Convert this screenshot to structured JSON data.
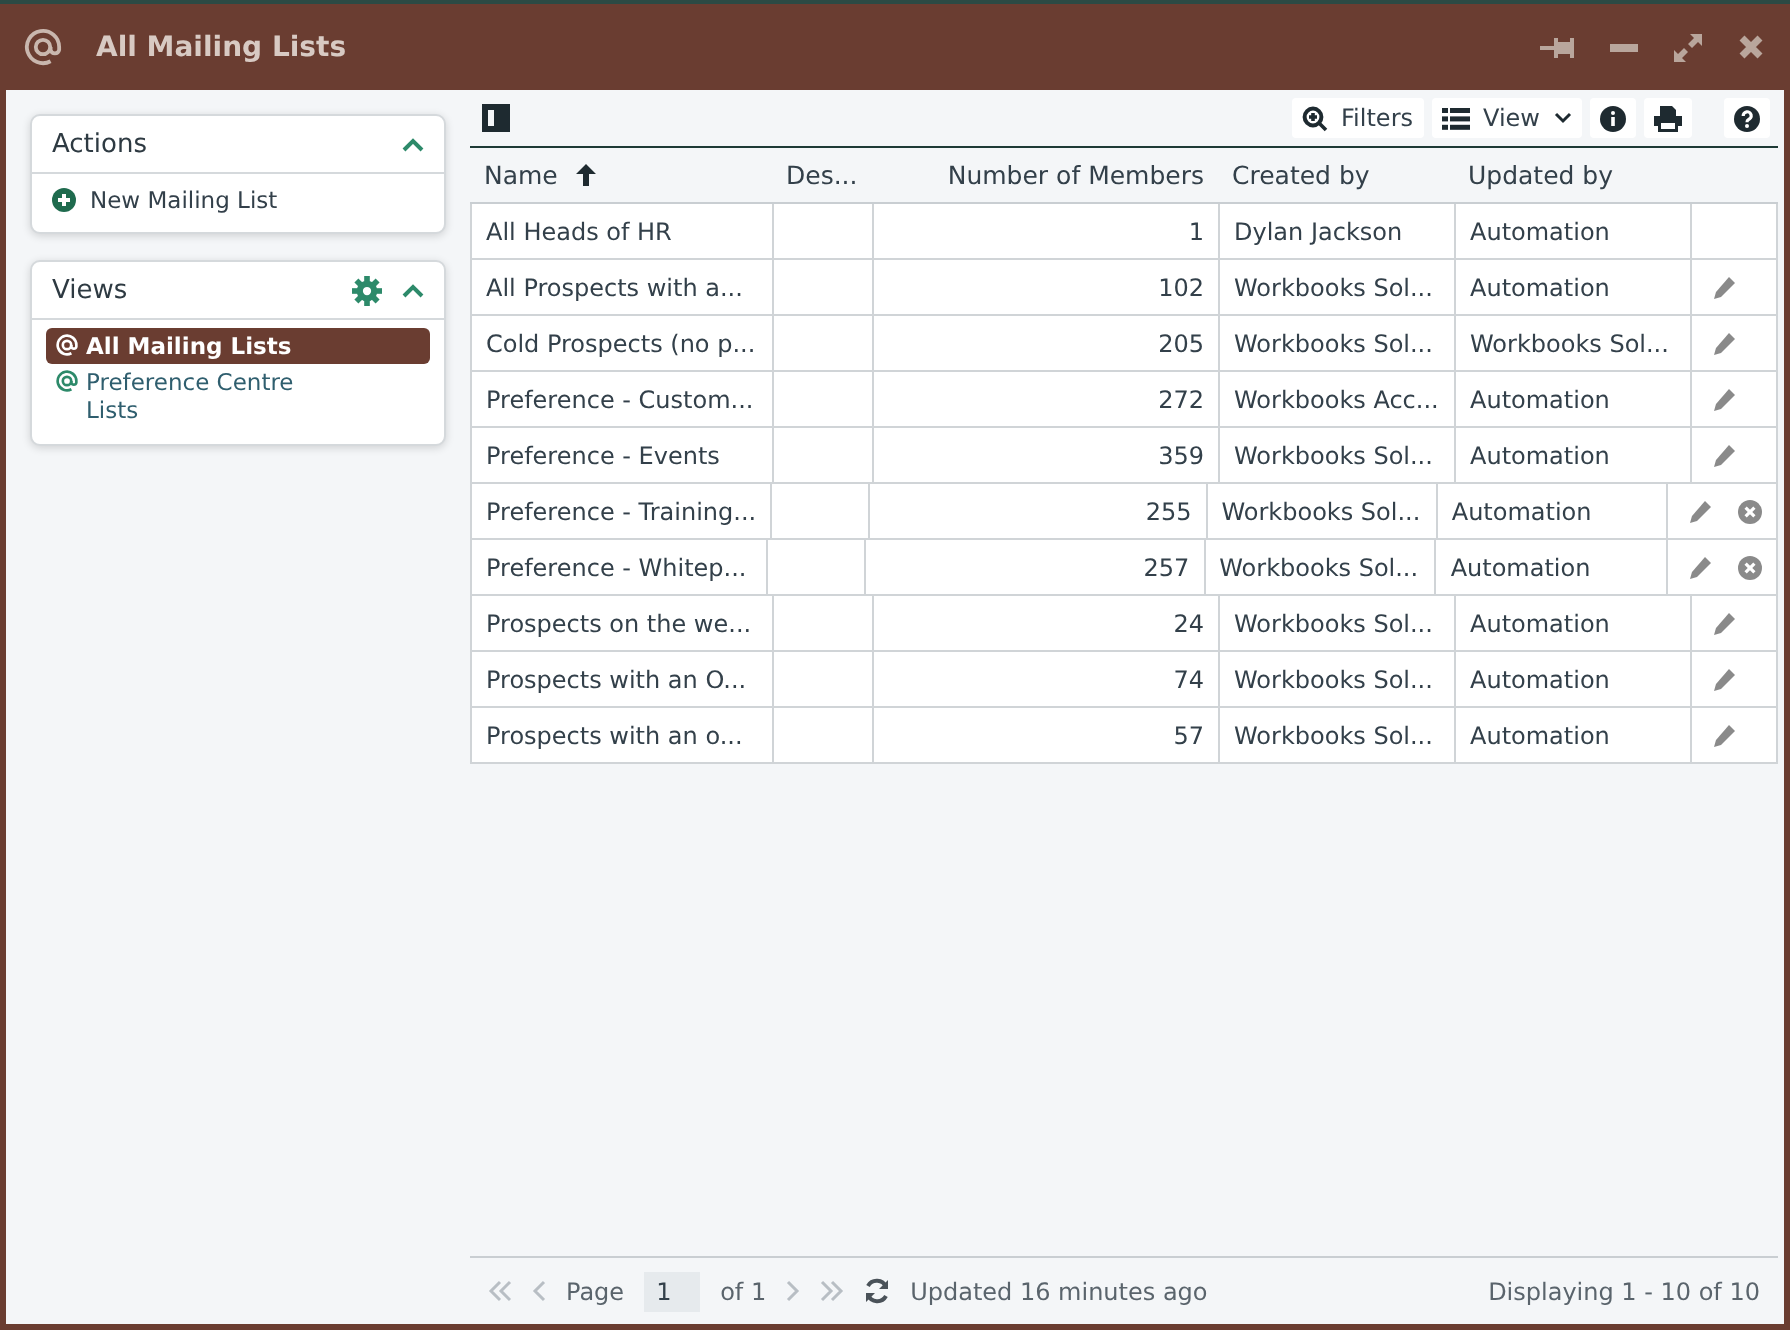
{
  "window": {
    "title": "All Mailing Lists"
  },
  "actions": {
    "title": "Actions",
    "expanded": true,
    "items": [
      {
        "label": "New Mailing List"
      }
    ]
  },
  "views": {
    "title": "Views",
    "expanded": true,
    "items": [
      {
        "label": "All Mailing Lists",
        "selected": true
      },
      {
        "label": "Preference Centre Lists",
        "selected": false
      }
    ]
  },
  "toolbar": {
    "filters": "Filters",
    "view": "View"
  },
  "table": {
    "columns": [
      {
        "label": "Name",
        "sorted": true
      },
      {
        "label": "Des...",
        "sorted": false
      },
      {
        "label": "Number of Members",
        "sorted": false
      },
      {
        "label": "Created by",
        "sorted": false
      },
      {
        "label": "Updated by",
        "sorted": false
      }
    ],
    "rows": [
      {
        "name": "All Heads of HR",
        "description": "",
        "members": "1",
        "created_by": "Dylan Jackson",
        "updated_by": "Automation",
        "editable": false,
        "deletable": false
      },
      {
        "name": "All Prospects with a...",
        "description": "",
        "members": "102",
        "created_by": "Workbooks Sol...",
        "updated_by": "Automation",
        "editable": true,
        "deletable": false
      },
      {
        "name": "Cold Prospects (no p...",
        "description": "",
        "members": "205",
        "created_by": "Workbooks Sol...",
        "updated_by": "Workbooks Sol...",
        "editable": true,
        "deletable": false
      },
      {
        "name": "Preference - Custom...",
        "description": "",
        "members": "272",
        "created_by": "Workbooks Acc...",
        "updated_by": "Automation",
        "editable": true,
        "deletable": false
      },
      {
        "name": "Preference - Events",
        "description": "",
        "members": "359",
        "created_by": "Workbooks Sol...",
        "updated_by": "Automation",
        "editable": true,
        "deletable": false
      },
      {
        "name": "Preference - Training...",
        "description": "",
        "members": "255",
        "created_by": "Workbooks Sol...",
        "updated_by": "Automation",
        "editable": true,
        "deletable": true
      },
      {
        "name": "Preference - Whitep...",
        "description": "",
        "members": "257",
        "created_by": "Workbooks Sol...",
        "updated_by": "Automation",
        "editable": true,
        "deletable": true
      },
      {
        "name": "Prospects on the we...",
        "description": "",
        "members": "24",
        "created_by": "Workbooks Sol...",
        "updated_by": "Automation",
        "editable": true,
        "deletable": false
      },
      {
        "name": "Prospects with an O...",
        "description": "",
        "members": "74",
        "created_by": "Workbooks Sol...",
        "updated_by": "Automation",
        "editable": true,
        "deletable": false
      },
      {
        "name": "Prospects with an o...",
        "description": "",
        "members": "57",
        "created_by": "Workbooks Sol...",
        "updated_by": "Automation",
        "editable": true,
        "deletable": false
      }
    ]
  },
  "pager": {
    "page_label": "Page",
    "page": "1",
    "of": "of 1",
    "updated": "Updated 16 minutes ago",
    "displaying": "Displaying 1 - 10 of 10"
  }
}
